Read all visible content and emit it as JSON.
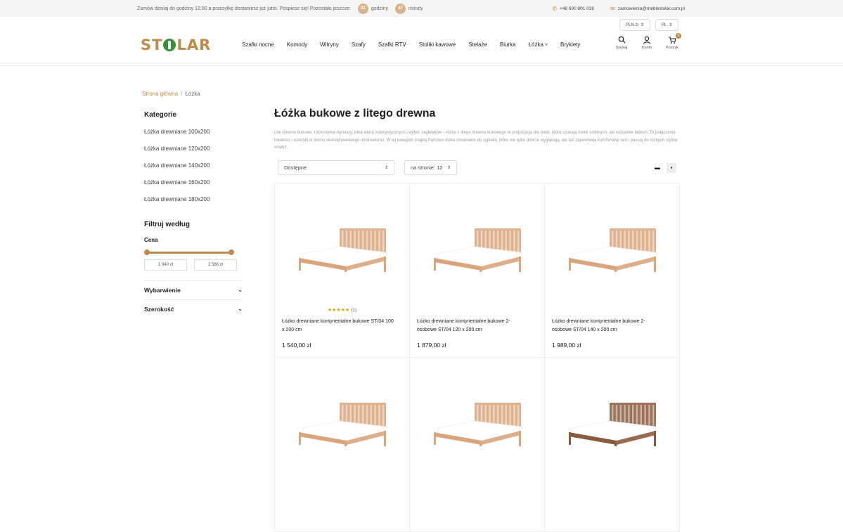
{
  "topbar": {
    "promo_text": "Zamów dzisiaj do godziny 12:00 a przesyłkę dostaniesz już jutro. Pospiesz się! Pozostało jeszcze:",
    "hours_value": "01",
    "hours_label": "godziny",
    "minutes_value": "47",
    "minutes_label": "minuty",
    "phone": "+48 690 801 026",
    "email": "zamowienia@meblestolar.com.pl"
  },
  "header": {
    "logo": "STOLAR",
    "currency": "PLN zł",
    "language": "PL",
    "nav": [
      "Szafki nocne",
      "Komody",
      "Witryny",
      "Szafy",
      "Szafki RTV",
      "Stoliki kawowe",
      "Stelaże",
      "Biurka",
      "Łóżka",
      "Brykiety"
    ],
    "icons": {
      "search_label": "Szukaj",
      "account_label": "Konto",
      "cart_label": "Koszyk",
      "cart_count": "0"
    }
  },
  "breadcrumb": {
    "home": "Strona główna",
    "current": "Łóżka"
  },
  "sidebar": {
    "categories_title": "Kategorie",
    "categories": [
      "Łóżka drewniane 100x200",
      "Łóżka drewniane 120x200",
      "Łóżka drewniane 140x200",
      "Łóżka drewniane 160x200",
      "Łóżka drewniane 180x200"
    ],
    "filter_title": "Filtruj według",
    "price_label": "Cena",
    "price_min": "1 940 zł",
    "price_max": "2 566 zł",
    "accordions": [
      "Wybarwienie",
      "Szerokość"
    ]
  },
  "main": {
    "title": "Łóżka bukowe z litego drewna",
    "description": "Lite drewno bukowe, różnorodne wymiary, kilka wersji kolorystycznych i wybór zagłówków – łóżka z litego drewna bukowego to propozycja dla osób, które szukają mebli solidnych, ale wizualnie lekkich. To połączenie trwałości i estetyki w duchu skandynawskiego minimalizmu. W tej kategorii znajdą Państwo łóżka drewniane do sypialni, które nie tylko dobrze wyglądają, ale też zapewniają komfortowy sen i pasują do różnych stylów wnętrz.",
    "sort_value": "Dostępne",
    "per_page_value": "na stronie: 12",
    "products": [
      {
        "name": "Łóżko drewniane kontynentalne bukowe ST/04 100 x 200 cm",
        "price": "1 540,00 zł",
        "stars": "★★★★★",
        "reviews": "(1)",
        "wood": "#d9a57a"
      },
      {
        "name": "Łóżko drewniane kontynentalne bukowe 2-osobowe ST/04 120 x 200 cm",
        "price": "1 879,00 zł",
        "stars": "",
        "reviews": "",
        "wood": "#d9a57a"
      },
      {
        "name": "Łóżko drewniane kontynentalne bukowe 2-osobowe ST/04 140 x 200 cm",
        "price": "1 989,00 zł",
        "stars": "",
        "reviews": "",
        "wood": "#d9a57a"
      },
      {
        "name": "",
        "price": "",
        "stars": "",
        "reviews": "",
        "wood": "#d9a57a"
      },
      {
        "name": "",
        "price": "",
        "stars": "",
        "reviews": "",
        "wood": "#d9a57a"
      },
      {
        "name": "",
        "price": "",
        "stars": "",
        "reviews": "",
        "wood": "#8a5a3c"
      }
    ]
  },
  "colors": {
    "accent": "#c08a4a",
    "logo_o": "#3a8f3a"
  }
}
